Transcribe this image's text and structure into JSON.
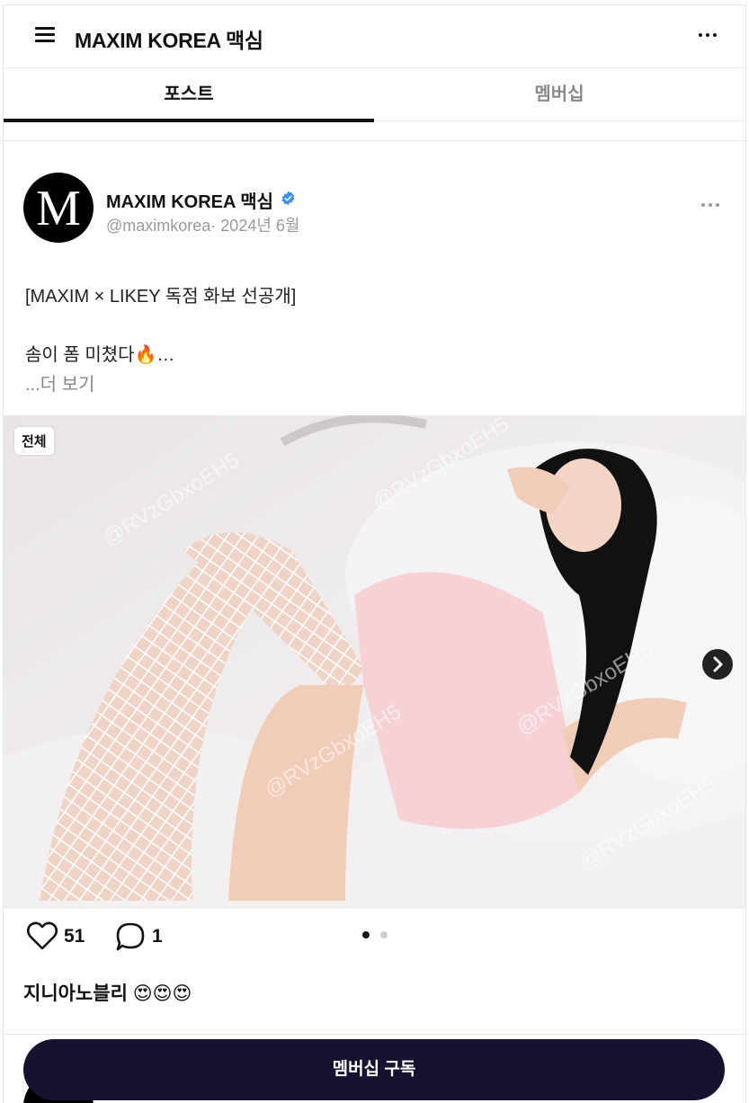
{
  "header": {
    "title": "MAXIM KOREA 맥심",
    "menu_icon": "hamburger-menu-icon",
    "more_icon": "more-horizontal-icon"
  },
  "tabs": [
    {
      "label": "포스트",
      "active": true
    },
    {
      "label": "멤버십",
      "active": false
    }
  ],
  "post": {
    "avatar_letter": "M",
    "author": "MAXIM KOREA 맥심",
    "verified_icon": "verified-badge-icon",
    "handle": "@maximkorea",
    "date": "2024년 6월",
    "text_line1": "[MAXIM × LIKEY 독점 화보 선공개]",
    "text_line2": "솜이 폼 미쳤다🔥…",
    "more_label": "...더 보기",
    "image": {
      "badge": "전체",
      "watermark": "@RVzGbxoEH5",
      "next_icon": "chevron-right-icon"
    },
    "likes": "51",
    "comments": "1",
    "carousel": {
      "current": 1,
      "total": 2
    },
    "caption": "지니아노블리 😍😍😍"
  },
  "subscribe_label": "멤버십 구독",
  "colors": {
    "primary_button": "#161331",
    "muted_text": "#9a9a9a",
    "verified": "#3b8ff0"
  }
}
